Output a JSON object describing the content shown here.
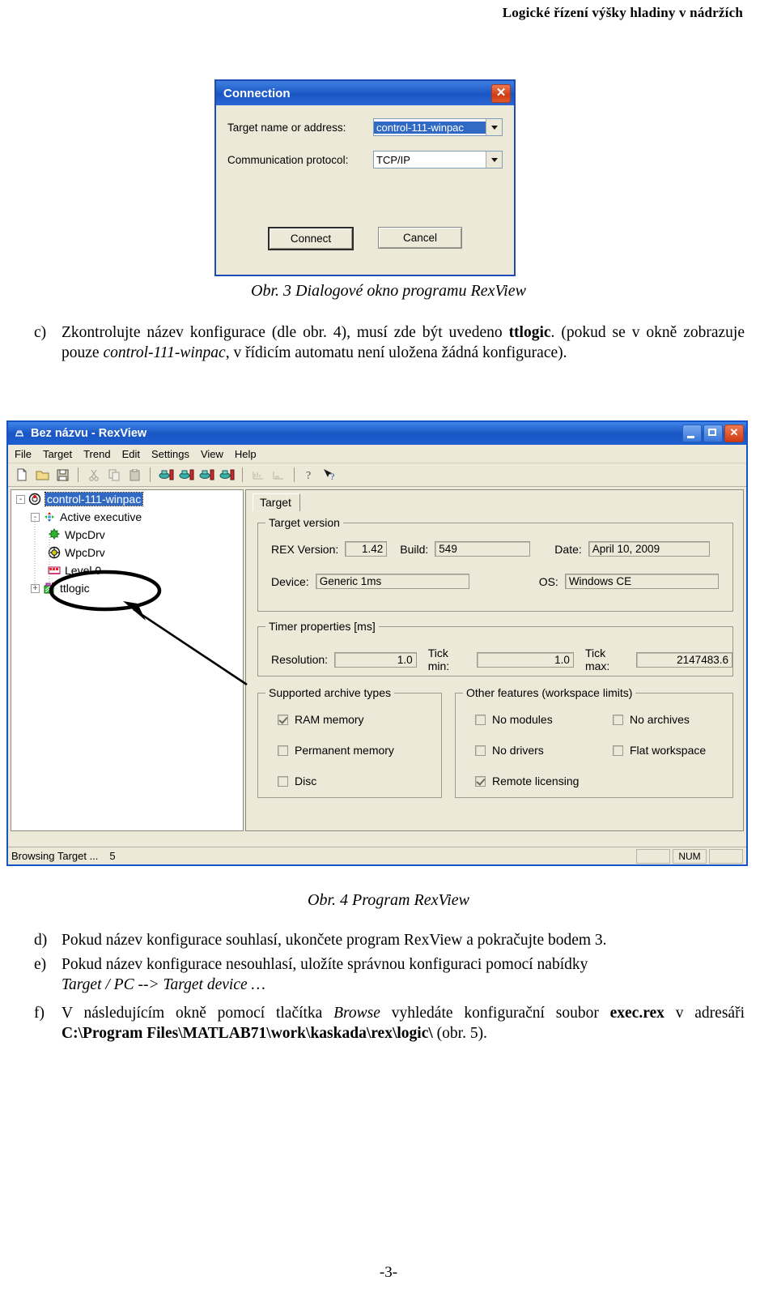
{
  "document": {
    "running_head": "Logické řízení výšky hladiny v nádržích",
    "page_number": "-3-"
  },
  "figure3": {
    "caption": "Obr. 3 Dialogové okno programu RexView",
    "dialog": {
      "title": "Connection",
      "close_icon": "close-icon",
      "fields": [
        {
          "label": "Target name or address:",
          "value": "control-111-winpac",
          "selected": true
        },
        {
          "label": "Communication protocol:",
          "value": "TCP/IP",
          "selected": false
        }
      ],
      "buttons": {
        "connect": "Connect",
        "cancel": "Cancel"
      }
    }
  },
  "paragraph_c": {
    "marker": "c)",
    "line1_a": "Zkontrolujte název konfigurace (dle obr. 4), musí zde být uvedeno ",
    "line1_bold": "ttlogic",
    "line1_b": ". (pokud se v okně zobrazuje pouze ",
    "line1_italic": "control-111-winpac",
    "line1_c": ", v řídicím automatu není uložena žádná konfigurace)."
  },
  "figure4": {
    "caption": "Obr. 4 Program RexView",
    "window": {
      "title": "Bez názvu - RexView",
      "app_icon": "rex-app-icon",
      "window_buttons": {
        "minimize": "minimize-icon",
        "maximize": "maximize-icon",
        "close": "close-icon"
      },
      "menu": [
        "File",
        "Target",
        "Trend",
        "Edit",
        "Settings",
        "View",
        "Help"
      ],
      "toolbar": [
        "new-icon",
        "open-icon",
        "save-icon",
        "cut-icon",
        "copy-icon",
        "paste-icon",
        "target-connect-icon",
        "target-disconnect-icon",
        "target-refresh-icon",
        "target-download-icon",
        "trend-icon",
        "trend-stop-icon",
        "help-icon",
        "context-help-icon"
      ],
      "tree": [
        {
          "label": "control-111-winpac",
          "icon": "target-icon",
          "expander": "-",
          "depth": 0,
          "selected": true
        },
        {
          "label": "Active executive",
          "icon": "executive-icon",
          "expander": "-",
          "depth": 1,
          "selected": false
        },
        {
          "label": "WpcDrv",
          "icon": "driver-icon",
          "expander": "",
          "depth": 2,
          "selected": false
        },
        {
          "label": "WpcDrv",
          "icon": "module-icon",
          "expander": "",
          "depth": 2,
          "selected": false
        },
        {
          "label": "Level 0",
          "icon": "level-icon",
          "expander": "",
          "depth": 2,
          "selected": false
        },
        {
          "label": "ttlogic",
          "icon": "task-icon",
          "expander": "+",
          "depth": 2,
          "selected": false,
          "annotated": true
        }
      ],
      "tab": "Target",
      "target_version": {
        "legend": "Target version",
        "rex_version_label": "REX Version:",
        "rex_version": "1.42",
        "build_label": "Build:",
        "build": "549",
        "date_label": "Date:",
        "date": "April 10, 2009",
        "device_label": "Device:",
        "device": "Generic 1ms",
        "os_label": "OS:",
        "os": "Windows CE"
      },
      "timer_properties": {
        "legend": "Timer properties [ms]",
        "resolution_label": "Resolution:",
        "resolution": "1.0",
        "tick_min_label": "Tick min:",
        "tick_min": "1.0",
        "tick_max_label": "Tick max:",
        "tick_max": "2147483.6"
      },
      "archive_types": {
        "legend": "Supported archive types",
        "items": [
          {
            "label": "RAM memory",
            "checked": true
          },
          {
            "label": "Permanent memory",
            "checked": false
          },
          {
            "label": "Disc",
            "checked": false
          }
        ]
      },
      "other_features": {
        "legend": "Other features (workspace limits)",
        "items": [
          {
            "label": "No modules",
            "checked": false
          },
          {
            "label": "No archives",
            "checked": false
          },
          {
            "label": "No drivers",
            "checked": false
          },
          {
            "label": "Flat workspace",
            "checked": false
          },
          {
            "label": "Remote licensing",
            "checked": true
          }
        ]
      },
      "statusbar": {
        "message": "Browsing Target ...",
        "count": "5",
        "num_indicator": "NUM"
      }
    }
  },
  "paragraph_d": {
    "marker": "d)",
    "text": "Pokud název konfigurace souhlasí, ukončete program RexView a pokračujte bodem 3."
  },
  "paragraph_e": {
    "marker": "e)",
    "text_a": "Pokud název konfigurace nesouhlasí, uložíte správnou konfiguraci pomocí nabídky ",
    "menu_path": "Target / PC --> Target device …"
  },
  "paragraph_f": {
    "marker": "f)",
    "text_a": "V následujícím okně pomocí tlačítka ",
    "browse": "Browse",
    "text_b": " vyhledáte konfigurační soubor ",
    "file": "exec.rex",
    "text_c": " v adresáři ",
    "path": "C:\\Program Files\\MATLAB71\\work\\kaskada\\rex\\logic\\",
    "text_d": " (obr. 5)."
  }
}
